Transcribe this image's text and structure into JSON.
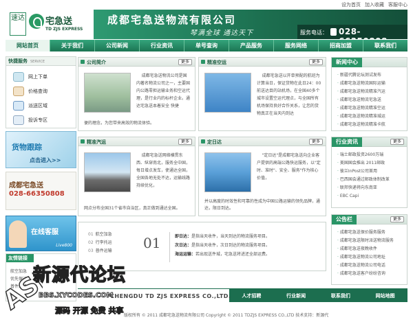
{
  "top_links": [
    "设为首页",
    "加入收藏",
    "客服中心"
  ],
  "logo": {
    "seal": "速达",
    "name": "宅急送",
    "en": "TD ZJS EXPRESS"
  },
  "banner": {
    "company": "成都宅急送物流有限公司",
    "slogan": "琴满全球 通达天下",
    "phone_label": "服务电话：",
    "phone": "028-66350808"
  },
  "nav": [
    "网站首页",
    "关于我们",
    "公司新闻",
    "行业资讯",
    "单号查询",
    "产品服务",
    "服务网络",
    "招商加盟",
    "联系我们"
  ],
  "quick_service": {
    "title": "快捷服务",
    "title_en": "SERVICE",
    "items": [
      {
        "label": "网上下单",
        "icon": "order-icon"
      },
      {
        "label": "价格查询",
        "icon": "price-icon"
      },
      {
        "label": "派送区域",
        "icon": "area-icon"
      },
      {
        "label": "投诉专区",
        "icon": "complaint-icon"
      }
    ]
  },
  "tracking": {
    "title": "货物跟踪",
    "cta": "点击进入>>"
  },
  "hotline": {
    "name": "成都宅急送",
    "phone": "028-66350808"
  },
  "online_service": {
    "title": "在线客服",
    "brand": "Live800"
  },
  "friend_links": {
    "title": "友情链接",
    "lines": [
      "航空加急",
      "优先保运",
      "普件运输"
    ]
  },
  "panels": {
    "intro": {
      "title": "公司简介",
      "more": "更多",
      "text": "成都宅急送物流公司是国内著名物流公司之一，主要国内公路零担运输业务和空运代理，是行业内的标杆企业。通达宅急送本着安全 快捷",
      "tail": "便的理念，为您带来高效的物流体验。"
    },
    "air": {
      "title": "精准空运",
      "more": "更多",
      "text": "成都宅急送以开单预配的航班为计算当日，保证货物在此日24：00前送达目的站机场，在全国40多个城市设置空运代理点，与全国所有机场保持良好合作关系，让您的货物真正在当天内到达",
      "tail": ""
    },
    "truck": {
      "title": "精准汽运",
      "more": "更多",
      "text": "成都宅急送网络横贯东西、纵穿南北，服务全中国，每日增点发车，使通达全国，全国各地无处不达，运输线路持续优化，",
      "tail": "网点分布全国31个省市自治区，真正做到通达全国。"
    },
    "daily": {
      "title": "定日达",
      "more": "更多",
      "text": "\"定日达\"是成都宅急送向企业客户提供的高端公路快运服务，以\"定 时、准时\"、安全、服务\"作为核心 价值，",
      "tail": "并以高度的时效性和可靠的性成为中国公路运输的领先品牌，通达，限日到达。"
    }
  },
  "news_center": {
    "title": "新闻中心",
    "more": "",
    "items": [
      "新疆代腾论坛测试发布",
      "成都宅急送物流国际运输",
      "成都宅急送物流精准汽运",
      "成都宅急送物流宅急送",
      "成都宅急送物流精准空运",
      "成都宅急送物流精准城运",
      "成都宅急送物流精准卡航"
    ]
  },
  "industry_news": {
    "title": "行业资讯",
    "more": "更多",
    "items": [
      "瑞士邮政投资2600万瑞",
      "美国国会推出 2011邮政",
      "彼兰InPost公司首用",
      "巴西国会通过邮政体制改革",
      "联邦快递将向东南亚",
      "EBC Capi"
    ]
  },
  "notices": {
    "title": "公告栏",
    "more": "更多",
    "items": [
      "成都宅急送保价服务服务",
      "成都宅急送限时派送物流服务",
      "成都宅急送夜晚收件",
      "成都宅急送物流公司地址",
      "成都宅急送物流公司电话",
      "成都宅急送客户纷纷咨询"
    ]
  },
  "service_list": {
    "items": [
      {
        "n": "01",
        "label": "航空加急"
      },
      {
        "n": "02",
        "label": "行李托运"
      },
      {
        "n": "03",
        "label": "普件运输"
      }
    ],
    "big_num": "01",
    "details": [
      {
        "k": "即日达：",
        "v": "是指当天收件，当天到达的物流服务项目。"
      },
      {
        "k": "次日达：",
        "v": "是指当天收件，次日到达的物流服务项目。"
      },
      {
        "k": "海运运输：",
        "v": "若出现送件城，宅急送将进还全部运费。"
      }
    ]
  },
  "footer_nav": [
    "人才招聘",
    "行业新闻",
    "联系我们",
    "网站地图"
  ],
  "footer_en": "CHENGDU TD ZJS EXPRESS CO.,LTD.",
  "copyright": "版权所有 © 2011 成都宅急送物流有限公司 Copyright © 2011 TDZJS EXPRESS CO.,LTD 技术支持：新源代",
  "watermark": {
    "title": "新源代论坛",
    "url": "BBS.XYCODES.COM",
    "tagline": "源码 开源 免费 共享"
  },
  "colors": {
    "brand_green": "#1c6e4f",
    "accent_green": "#2a9567",
    "phone_red": "#c0392b"
  }
}
